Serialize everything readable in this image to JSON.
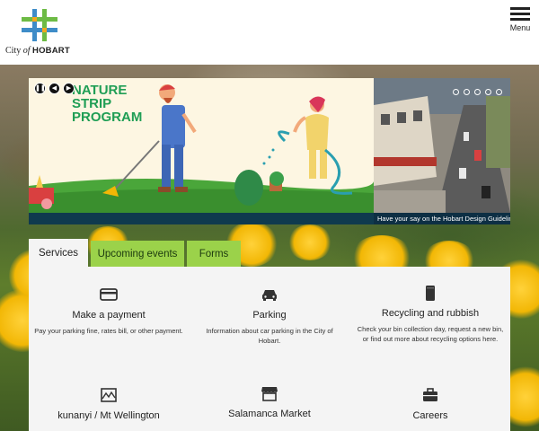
{
  "header": {
    "logo": {
      "city": "City",
      "of": "of",
      "name": "HOBART"
    },
    "menu_label": "Menu"
  },
  "carousel": {
    "controls": [
      "pause-icon",
      "previous-icon",
      "next-icon"
    ],
    "main_slide": {
      "title_line1": "NATURE",
      "title_line2": "STRIP",
      "title_line3": "PROGRAM"
    },
    "side_slide": {
      "caption": "Have your say on the Hobart Design Guidelin"
    },
    "dot_count": 5
  },
  "tabs": [
    {
      "label": "Services",
      "active": true
    },
    {
      "label": "Upcoming events",
      "active": false
    },
    {
      "label": "Forms",
      "active": false
    }
  ],
  "services": [
    {
      "icon": "credit-card-icon",
      "title": "Make a payment",
      "desc": "Pay your parking fine, rates bill, or other payment."
    },
    {
      "icon": "car-icon",
      "title": "Parking",
      "desc": "Information about car parking in the City of Hobart."
    },
    {
      "icon": "bin-icon",
      "title": "Recycling and rubbish",
      "desc": "Check your bin collection day, request a new bin, or find out more about recycling options here."
    },
    {
      "icon": "mountain-map-icon",
      "title": "kunanyi / Mt Wellington",
      "desc": ""
    },
    {
      "icon": "market-stall-icon",
      "title": "Salamanca Market",
      "desc": ""
    },
    {
      "icon": "briefcase-icon",
      "title": "Careers",
      "desc": ""
    }
  ],
  "colors": {
    "tab_inactive": "#9bd24a",
    "title_green": "#1f9e55",
    "carousel_bar": "#0f3a4e"
  }
}
